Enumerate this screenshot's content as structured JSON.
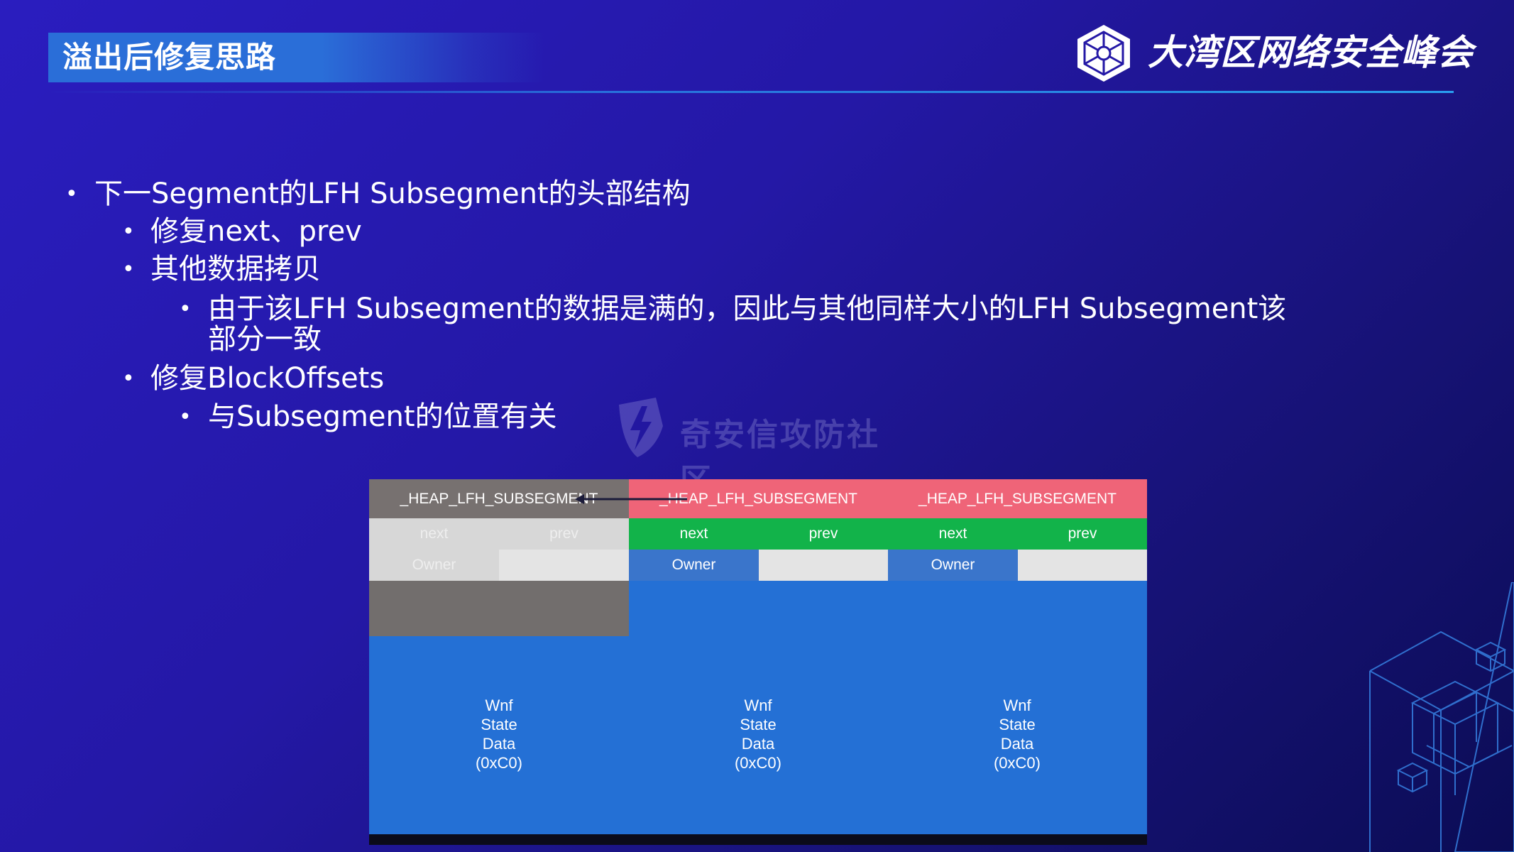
{
  "header": {
    "title": "溢出后修复思路",
    "brand": "大湾区网络安全峰会",
    "logo_icon": "bcs-cube-logo-icon"
  },
  "bullets": [
    {
      "level": 1,
      "text": "下一Segment的LFH Subsegment的头部结构"
    },
    {
      "level": 2,
      "text": "修复next、prev"
    },
    {
      "level": 2,
      "text": "其他数据拷贝"
    },
    {
      "level": 3,
      "text": "由于该LFH Subsegment的数据是满的，因此与其他同样大小的LFH Subsegment该"
    },
    {
      "level": 3,
      "text": "部分一致",
      "continuation": true
    },
    {
      "level": 2,
      "text": "修复BlockOffsets"
    },
    {
      "level": 3,
      "text": "与Subsegment的位置有关"
    }
  ],
  "watermark": {
    "text": "奇安信攻防社区",
    "icon": "shield-lightning-icon"
  },
  "diagram": {
    "colors": {
      "grey_header": "#777170",
      "red_header": "#ef6478",
      "green": "#12b34a",
      "light_grey": "#d7d7d7",
      "very_light": "#e4e4e4",
      "blue_owner": "#3a75cb",
      "blue_body": "#2470d5",
      "dark_grey_block": "#726e6d"
    },
    "columns": [
      {
        "header": "_HEAP_LFH_SUBSEGMENT",
        "next": "next",
        "prev": "prev",
        "owner": "Owner",
        "body": [
          "Wnf",
          "State",
          "Data",
          "(0xC0)"
        ]
      },
      {
        "header": "_HEAP_LFH_SUBSEGMENT",
        "next": "next",
        "prev": "prev",
        "owner": "Owner",
        "body": [
          "Wnf",
          "State",
          "Data",
          "(0xC0)"
        ]
      },
      {
        "header": "_HEAP_LFH_SUBSEGMENT",
        "next": "next",
        "prev": "prev",
        "owner": "Owner",
        "body": [
          "Wnf",
          "State",
          "Data",
          "(0xC0)"
        ]
      }
    ]
  }
}
